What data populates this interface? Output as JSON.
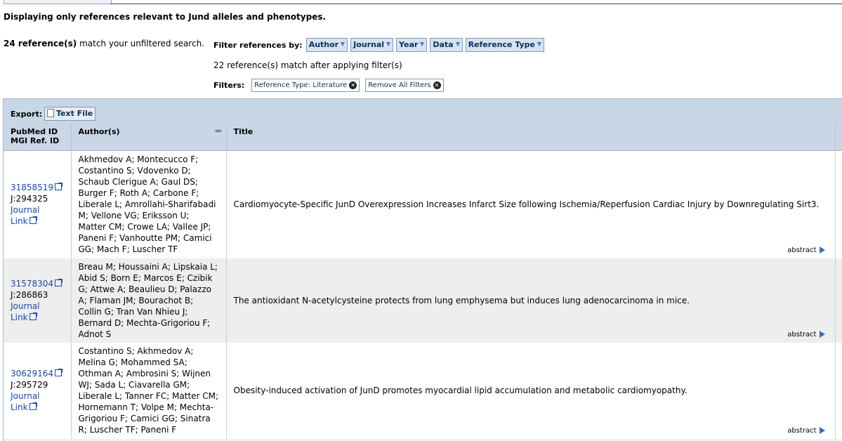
{
  "intro_text": "Displaying only references relevant to Jund alleles and phenotypes.",
  "summary": {
    "count_bold": "24 reference(s)",
    "count_rest": " match your unfiltered search."
  },
  "filterbar": {
    "label": "Filter references by:",
    "buttons": [
      "Author",
      "Journal",
      "Year",
      "Data",
      "Reference Type"
    ]
  },
  "after_filter_text": "22 reference(s) match after applying filter(s)",
  "active_filters": {
    "label": "Filters:",
    "chips": [
      "Reference Type: Literature",
      "Remove All Filters"
    ]
  },
  "export": {
    "label": "Export:",
    "button": "Text File"
  },
  "table": {
    "headers": {
      "id_line1": "PubMed ID",
      "id_line2": "MGI Ref. ID",
      "authors": "Author(s)",
      "title": "Title"
    },
    "rows": [
      {
        "pubmed": "31858519",
        "mgi": "J:294325",
        "journal_link_1": "Journal",
        "journal_link_2": "Link",
        "authors": "Akhmedov A; Montecucco F; Costantino S; Vdovenko D; Schaub Clerigue A; Gaul DS; Burger F; Roth A; Carbone F; Liberale L; Amrollahi-Sharifabadi M; Vellone VG; Eriksson U; Matter CM; Crowe LA; Vallee JP; Paneni F; Vanhoutte PM; Camici GG; Mach F; Luscher TF",
        "title": "Cardiomyocyte-Specific JunD Overexpression Increases Infarct Size following Ischemia/Reperfusion Cardiac Injury by Downregulating Sirt3.",
        "abstract": "abstract"
      },
      {
        "pubmed": "31578304",
        "mgi": "J:286863",
        "journal_link_1": "Journal",
        "journal_link_2": "Link",
        "authors": "Breau M; Houssaini A; Lipskaia L; Abid S; Born E; Marcos E; Czibik G; Attwe A; Beaulieu D; Palazzo A; Flaman JM; Bourachot B; Collin G; Tran Van Nhieu J; Bernard D; Mechta-Grigoriou F; Adnot S",
        "title": "The antioxidant N-acetylcysteine protects from lung emphysema but induces lung adenocarcinoma in mice.",
        "abstract": "abstract"
      },
      {
        "pubmed": "30629164",
        "mgi": "J:295729",
        "journal_link_1": "Journal",
        "journal_link_2": "Link",
        "authors": "Costantino S; Akhmedov A; Melina G; Mohammed SA; Othman A; Ambrosini S; Wijnen WJ; Sada L; Ciavarella GM; Liberale L; Tanner FC; Matter CM; Hornemann T; Volpe M; Mechta-Grigoriou F; Camici GG; Sinatra R; Luscher TF; Paneni F",
        "title": "Obesity-induced activation of JunD promotes myocardial lipid accumulation and metabolic cardiomyopathy.",
        "abstract": "abstract"
      }
    ]
  },
  "colors": {
    "header_bg": "#c9d6e6",
    "link": "#1a4aa3",
    "filter_button_bg": "#d7e3f1"
  }
}
